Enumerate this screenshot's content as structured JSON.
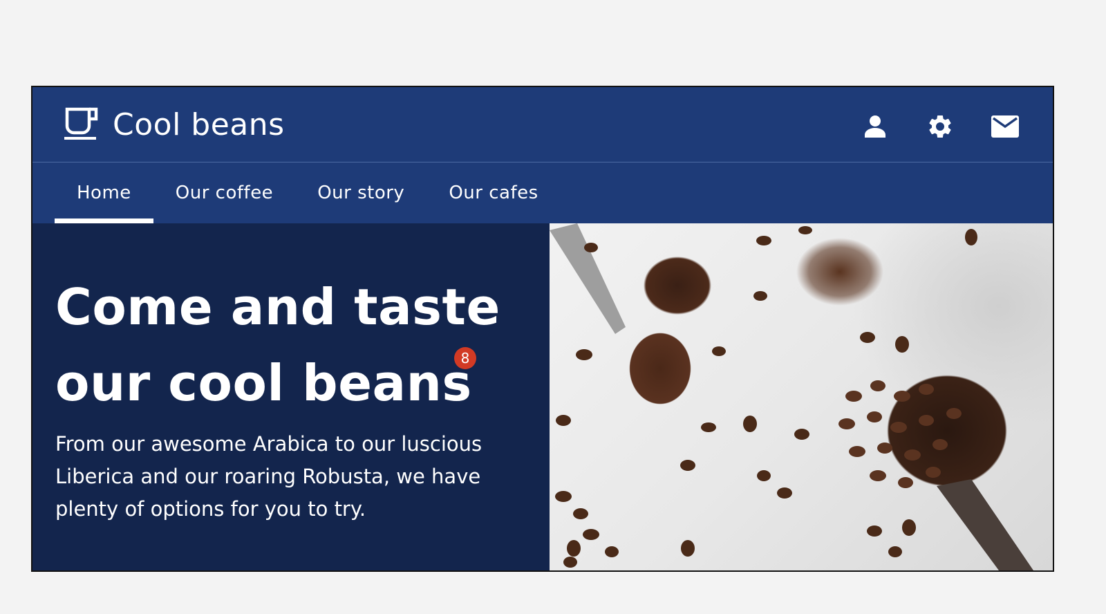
{
  "header": {
    "brand_name": "Cool beans",
    "logo_icon": "coffee-cup-icon",
    "actions": [
      {
        "name": "account",
        "icon": "person-icon"
      },
      {
        "name": "settings",
        "icon": "gear-icon"
      },
      {
        "name": "messages",
        "icon": "mail-icon"
      }
    ]
  },
  "nav": {
    "tabs": [
      {
        "label": "Home",
        "active": true
      },
      {
        "label": "Our coffee",
        "active": false
      },
      {
        "label": "Our story",
        "active": false
      },
      {
        "label": "Our cafes",
        "active": false
      }
    ]
  },
  "hero": {
    "title_line1": "Come and taste",
    "title_line2": "our cool beans",
    "badge_count": "8",
    "description": "From our awesome Arabica to our luscious Liberica and our roaring Robusta, we have plenty of options for you to try.",
    "image_alt": "Coffee beans and ground coffee in spoon and measuring cup"
  },
  "colors": {
    "header_bg": "#1e3b78",
    "hero_bg": "#13254d",
    "badge": "#d23a24",
    "page_bg": "#f3f3f3"
  }
}
